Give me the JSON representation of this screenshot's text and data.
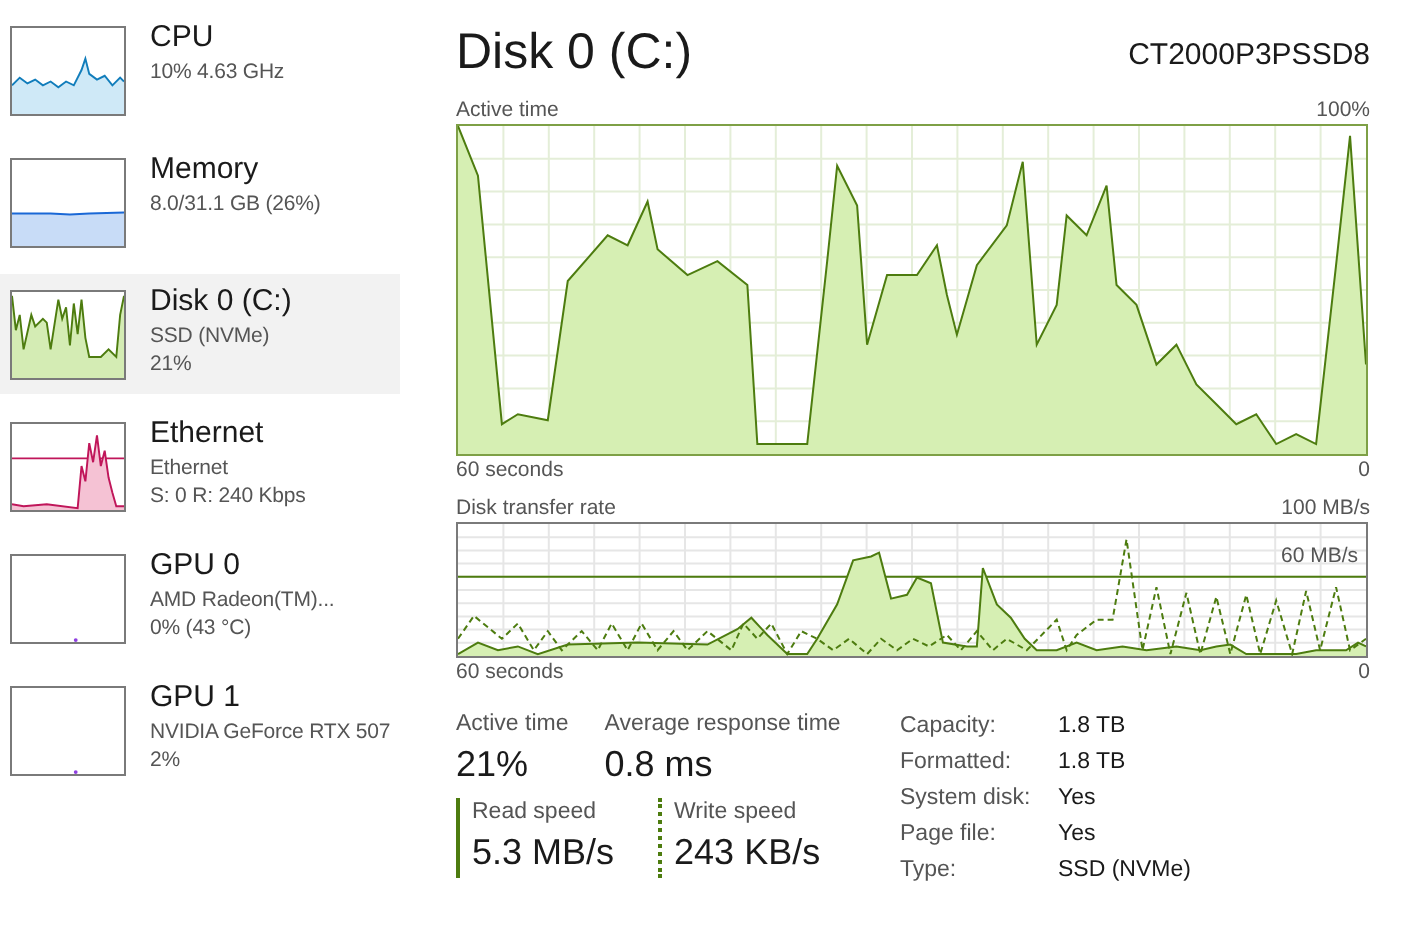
{
  "sidebar": {
    "items": [
      {
        "kind": "cpu",
        "name": "CPU",
        "line1": "10% 4.63 GHz",
        "selected": false
      },
      {
        "kind": "memory",
        "name": "Memory",
        "line1": "8.0/31.1 GB (26%)",
        "selected": false
      },
      {
        "kind": "disk",
        "name": "Disk 0 (C:)",
        "line1": "SSD (NVMe)",
        "line2": "21%",
        "selected": true
      },
      {
        "kind": "ethernet",
        "name": "Ethernet",
        "line1": "Ethernet",
        "line2": "S: 0 R: 240 Kbps",
        "selected": false
      },
      {
        "kind": "gpu",
        "name": "GPU 0",
        "line1": "AMD Radeon(TM)...",
        "line2": "0% (43 °C)",
        "selected": false
      },
      {
        "kind": "gpu",
        "name": "GPU 1",
        "line1": "NVIDIA GeForce RTX 507",
        "line2": "2%",
        "selected": false
      }
    ]
  },
  "header": {
    "title": "Disk 0 (C:)",
    "model": "CT2000P3PSSD8"
  },
  "active_chart": {
    "label": "Active time",
    "max": "100%",
    "xleft": "60 seconds",
    "xright": "0"
  },
  "transfer_chart": {
    "label": "Disk transfer rate",
    "max": "100 MB/s",
    "line_label": "60 MB/s",
    "xleft": "60 seconds",
    "xright": "0"
  },
  "stats": [
    {
      "label": "Active time",
      "value": "21%"
    },
    {
      "label": "Average response time",
      "value": "0.8 ms"
    }
  ],
  "speeds": [
    {
      "kind": "read",
      "label": "Read speed",
      "value": "5.3 MB/s"
    },
    {
      "kind": "write",
      "label": "Write speed",
      "value": "243 KB/s"
    }
  ],
  "properties": [
    {
      "label": "Capacity:",
      "value": "1.8 TB"
    },
    {
      "label": "Formatted:",
      "value": "1.8 TB"
    },
    {
      "label": "System disk:",
      "value": "Yes"
    },
    {
      "label": "Page file:",
      "value": "Yes"
    },
    {
      "label": "Type:",
      "value": "SSD (NVMe)"
    }
  ]
}
